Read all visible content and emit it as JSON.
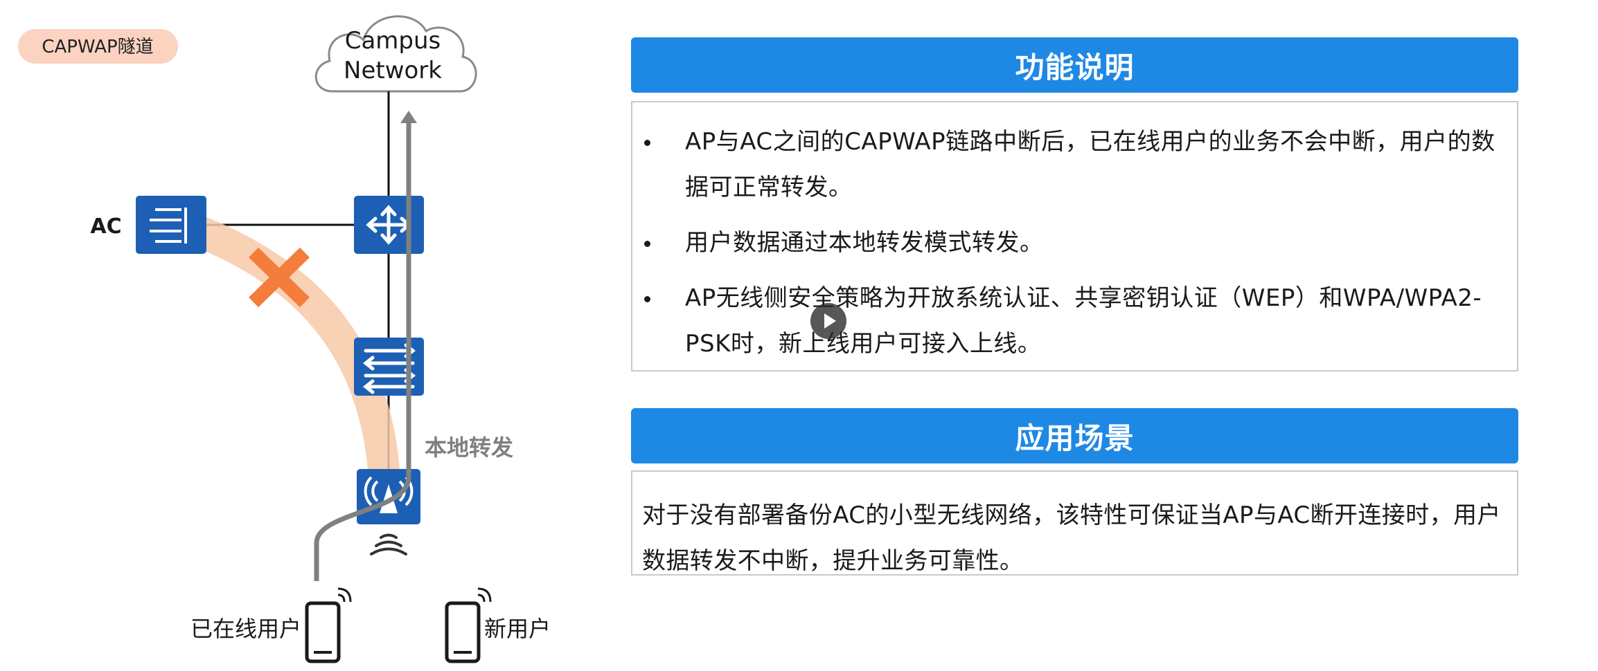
{
  "diagram": {
    "tunnel_badge": "CAPWAP隧道",
    "cloud_line1": "Campus",
    "cloud_line2": "Network",
    "ac_label": "AC",
    "local_forward_label": "本地转发",
    "online_user_label": "已在线用户",
    "new_user_label": "新用户",
    "colors": {
      "device_blue": "#1d5fb5",
      "tunnel_orange": "#f8c9a8",
      "cross_orange": "#f47d3c",
      "badge_bg": "#fbd3c0",
      "path_gray": "#808080"
    }
  },
  "function_panel": {
    "title": "功能说明",
    "bullets": [
      "AP与AC之间的CAPWAP链路中断后，已在线用户的业务不会中断，用户的数据可正常转发。",
      "用户数据通过本地转发模式转发。",
      "AP无线侧安全策略为开放系统认证、共享密钥认证（WEP）和WPA/WPA2-PSK时，新上线用户可接入上线。"
    ]
  },
  "scenario_panel": {
    "title": "应用场景",
    "text": "对于没有部署备份AC的小型无线网络，该特性可保证当AP与AC断开连接时，用户数据转发不中断，提升业务可靠性。"
  },
  "icons": {
    "play": "play-icon",
    "ac": "ac-controller-icon",
    "router": "router-icon",
    "switch": "switch-icon",
    "ap": "access-point-icon",
    "phone": "smartphone-icon",
    "cloud": "cloud-icon",
    "cross": "cross-icon"
  }
}
